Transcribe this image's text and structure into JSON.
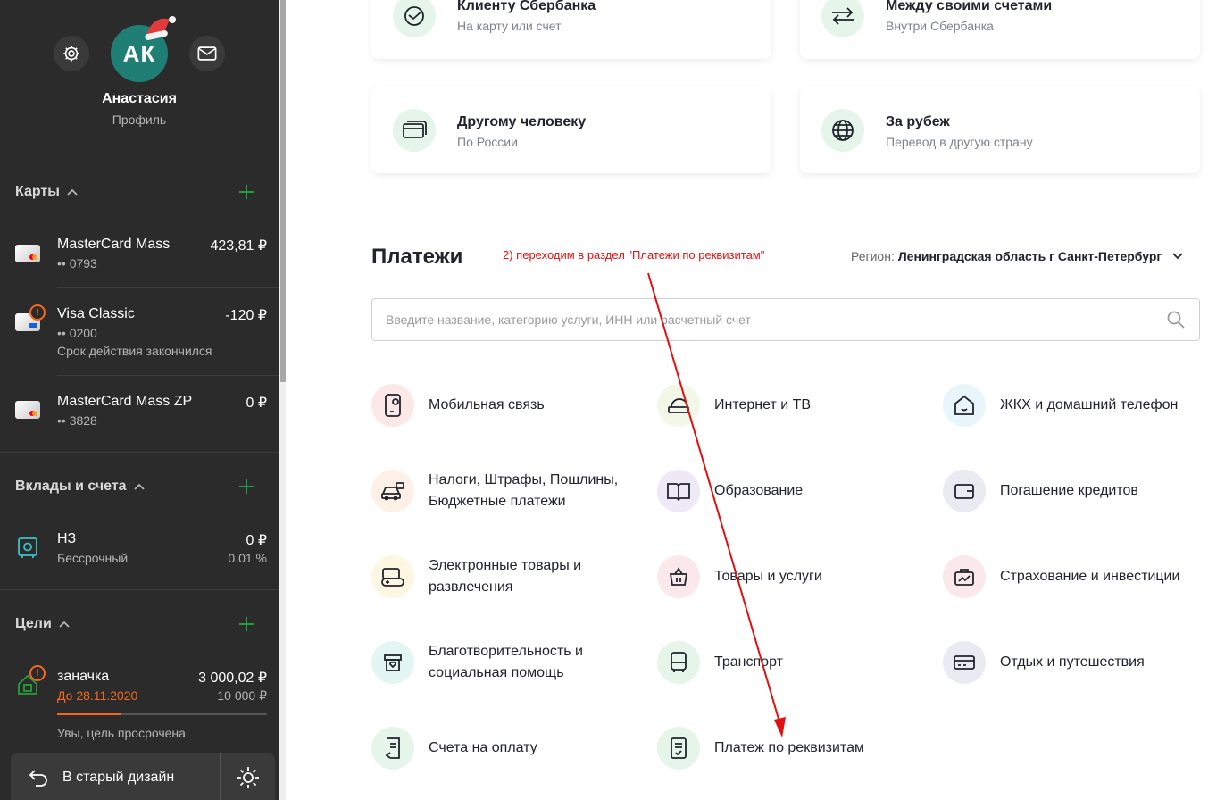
{
  "profile": {
    "initials": "АК",
    "name": "Анастасия",
    "subtitle": "Профиль"
  },
  "icons": {
    "settings": "gear-icon",
    "messages": "mail-icon",
    "add": "plus-icon",
    "collapse": "chevron-up-icon"
  },
  "sidebar": {
    "cards": {
      "title": "Карты",
      "items": [
        {
          "name": "MasterCard Mass",
          "number": "•• 0793",
          "amount": "423,81 ₽"
        },
        {
          "name": "Visa Classic",
          "number": "•• 0200",
          "amount": "-120 ₽",
          "note": "Срок действия закончился"
        },
        {
          "name": "MasterCard Mass ZP",
          "number": "•• 3828",
          "amount": "0 ₽"
        }
      ]
    },
    "deposits": {
      "title": "Вклады и счета",
      "items": [
        {
          "name": "НЗ",
          "subtitle": "Бессрочный",
          "amount": "0 ₽",
          "rate": "0.01 %"
        }
      ]
    },
    "goals": {
      "title": "Цели",
      "items": [
        {
          "name": "заначка",
          "deadline": "До 28.11.2020",
          "amount": "3 000,02 ₽",
          "target": "10 000 ₽",
          "progress": 0.3,
          "note": "Увы, цель просрочена"
        }
      ]
    },
    "bottom": {
      "old_design": "В старый дизайн"
    }
  },
  "transfers": [
    {
      "title": "Клиенту Сбербанка",
      "subtitle": "На карту или счет",
      "icon": "sber-icon"
    },
    {
      "title": "Между своими счетами",
      "subtitle": "Внутри Сбербанка",
      "icon": "swap-arrows-icon"
    },
    {
      "title": "Другому человеку",
      "subtitle": "По России",
      "icon": "cards-icon"
    },
    {
      "title": "За рубеж",
      "subtitle": "Перевод в другую страну",
      "icon": "globe-icon"
    }
  ],
  "payments": {
    "title": "Платежи",
    "annotation": "2) переходим в раздел \"Платежи по реквизитам\"",
    "region_label": "Регион:",
    "region_value": "Ленинградская область г Санкт-Петербург",
    "search_placeholder": "Введите название, категорию услуги, ИНН или расчетный счет",
    "categories": [
      {
        "label": "Мобильная связь",
        "icon": "phone-icon"
      },
      {
        "label": "Интернет и ТВ",
        "icon": "router-icon"
      },
      {
        "label": "ЖКХ и домашний телефон",
        "icon": "house-icon"
      },
      {
        "label": "Налоги, Штрафы, Пошлины, Бюджетные платежи",
        "icon": "car-icon"
      },
      {
        "label": "Образование",
        "icon": "book-icon"
      },
      {
        "label": "Погашение кредитов",
        "icon": "wallet-icon"
      },
      {
        "label": "Электронные товары и развлечения",
        "icon": "gamepad-icon"
      },
      {
        "label": "Товары и услуги",
        "icon": "basket-icon"
      },
      {
        "label": "Страхование и инвестиции",
        "icon": "briefcase-chart-icon"
      },
      {
        "label": "Благотворительность и социальная помощь",
        "icon": "charity-box-icon"
      },
      {
        "label": "Транспорт",
        "icon": "bus-icon"
      },
      {
        "label": "Отдых и путешествия",
        "icon": "ticket-icon"
      },
      {
        "label": "Счета на оплату",
        "icon": "invoice-icon"
      },
      {
        "label": "Платеж по реквизитам",
        "icon": "document-check-icon"
      }
    ]
  },
  "colors": {
    "sidebar_bg": "#2b2b2b",
    "accent_green": "#21a038",
    "warning_orange": "#f26822",
    "annotation_red": "#e01010"
  }
}
